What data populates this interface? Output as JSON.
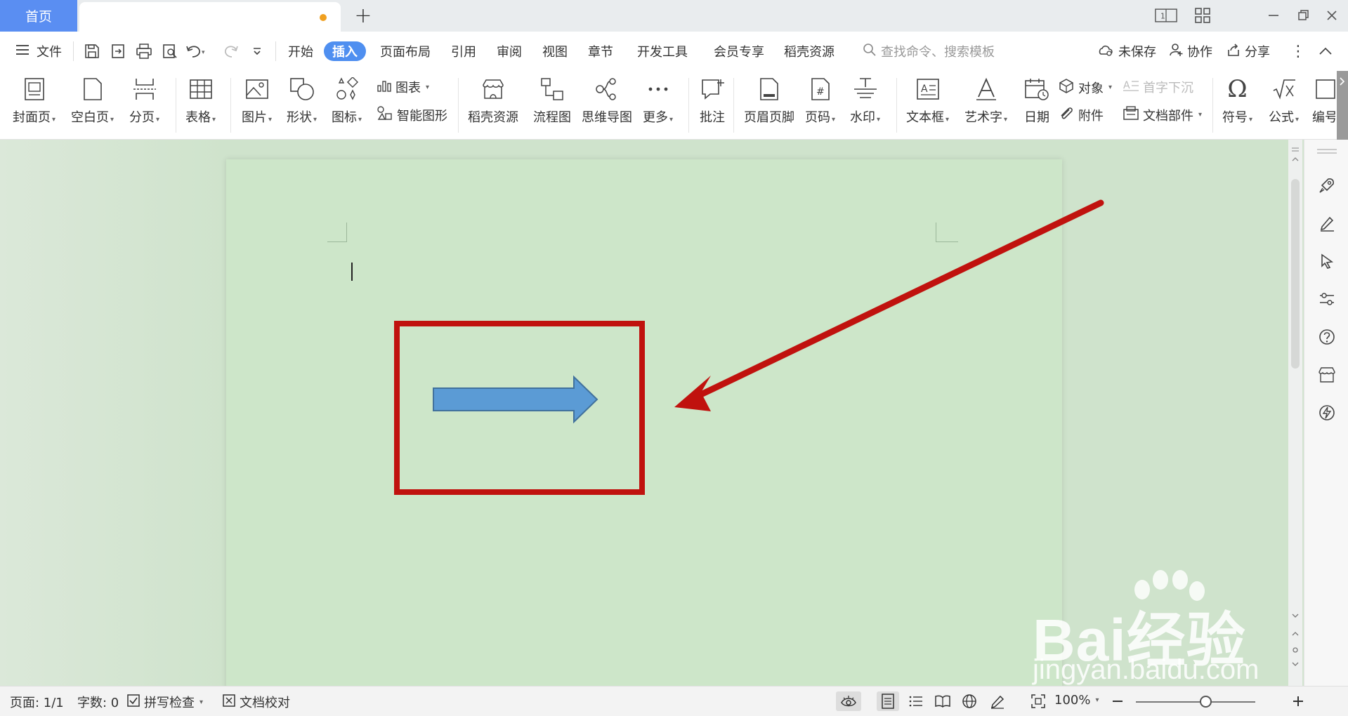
{
  "tabs": {
    "home": "首页",
    "new_tab": "+"
  },
  "menu": {
    "file": "文件",
    "items": [
      "开始",
      "插入",
      "页面布局",
      "引用",
      "审阅",
      "视图",
      "章节",
      "开发工具",
      "会员专享",
      "稻壳资源"
    ],
    "active": "插入",
    "search_placeholder": "查找命令、搜索模板",
    "unsaved": "未保存",
    "collab": "协作",
    "share": "分享"
  },
  "ribbon": {
    "cover": "封面页",
    "blank": "空白页",
    "page_break": "分页",
    "table": "表格",
    "picture": "图片",
    "shape": "形状",
    "icon": "图标",
    "chart": "图表",
    "smart_shape": "智能图形",
    "docer": "稻壳资源",
    "flowchart": "流程图",
    "mindmap": "思维导图",
    "more": "更多",
    "comment": "批注",
    "header_footer": "页眉页脚",
    "page_number": "页码",
    "watermark": "水印",
    "textbox": "文本框",
    "wordart": "艺术字",
    "date": "日期",
    "object": "对象",
    "dropcap": "首字下沉",
    "attachment": "附件",
    "doc_parts": "文档部件",
    "symbol": "符号",
    "formula": "公式",
    "edit": "编号"
  },
  "status": {
    "page": "页面: 1/1",
    "words": "字数: 0",
    "spell": "拼写检查",
    "proof": "文档校对",
    "zoom": "100%"
  },
  "watermark": {
    "brand": "Bai经验",
    "url": "jingyan.baidu.com"
  },
  "colors": {
    "accent": "#4f8ff0",
    "doc_bg": "#cfe3cc",
    "highlight_red": "#c0120e",
    "arrow_fill": "#5b9bd5",
    "arrow_stroke": "#41719c"
  }
}
